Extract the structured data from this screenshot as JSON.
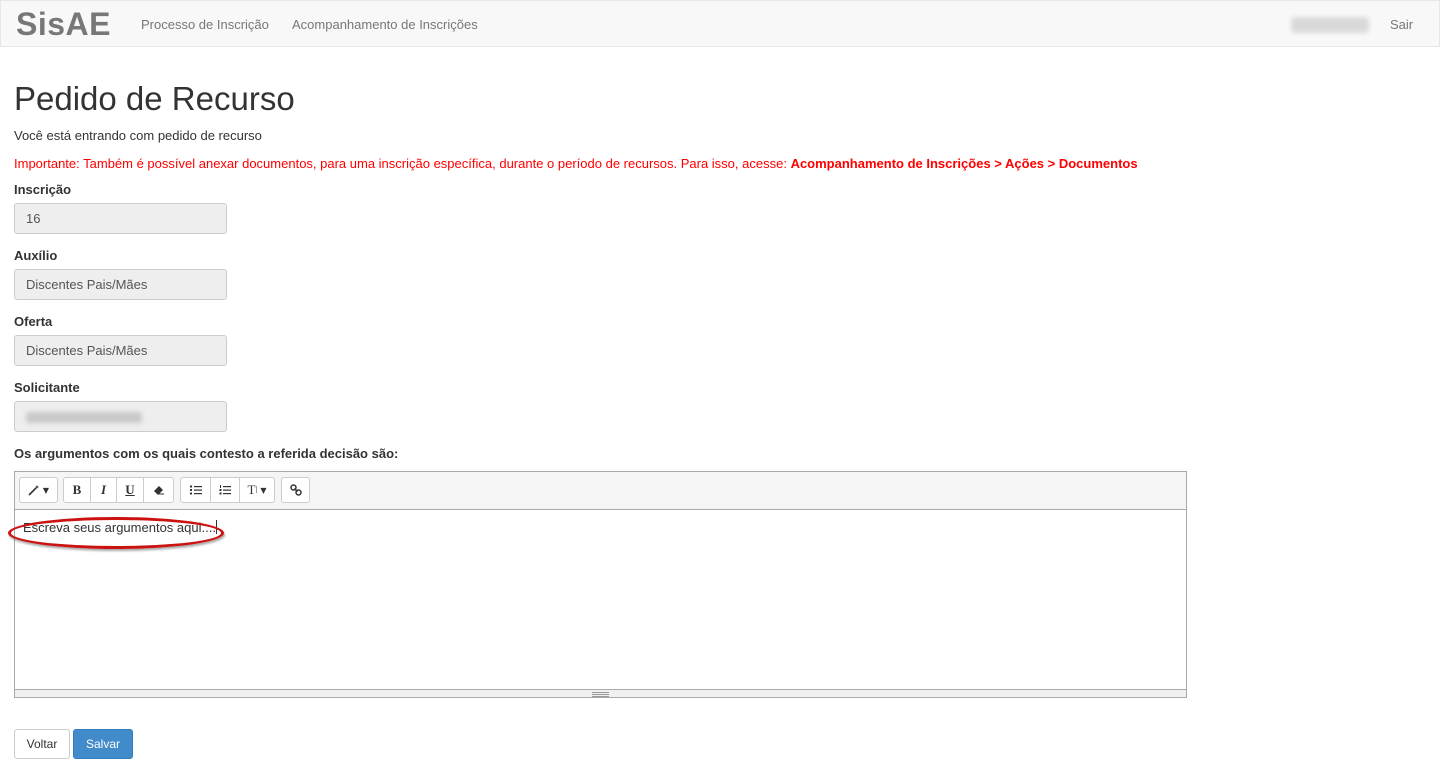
{
  "navbar": {
    "brand": "SisAE",
    "links": [
      "Processo de Inscrição",
      "Acompanhamento de Inscrições"
    ],
    "logout": "Sair"
  },
  "page": {
    "title": "Pedido de Recurso",
    "intro": "Você está entrando com pedido de recurso",
    "warning_text": "Importante: Também é possível anexar documentos, para uma inscrição específica, durante o período de recursos. Para isso, acesse: ",
    "warning_path": "Acompanhamento de Inscrições > Ações > Documentos"
  },
  "form": {
    "inscricao": {
      "label": "Inscrição",
      "value": "16"
    },
    "auxilio": {
      "label": "Auxílio",
      "value": "Discentes Pais/Mães"
    },
    "oferta": {
      "label": "Oferta",
      "value": "Discentes Pais/Mães"
    },
    "solicitante": {
      "label": "Solicitante"
    },
    "arguments_label": "Os argumentos com os quais contesto a referida decisão são:",
    "arguments_placeholder": "Escreva seus argumentos aqui....",
    "editor_toolbar": {
      "style_icon": "magic-wand-icon",
      "bold": "B",
      "italic": "I",
      "underline": "U",
      "eraser_icon": "eraser-icon",
      "ul_icon": "unordered-list-icon",
      "ol_icon": "ordered-list-icon",
      "line_height": "T",
      "link_icon": "link-icon"
    }
  },
  "buttons": {
    "back": "Voltar",
    "save": "Salvar"
  },
  "colors": {
    "warning": "#ff0000",
    "primary": "#428bca",
    "highlight": "#cc1111"
  }
}
